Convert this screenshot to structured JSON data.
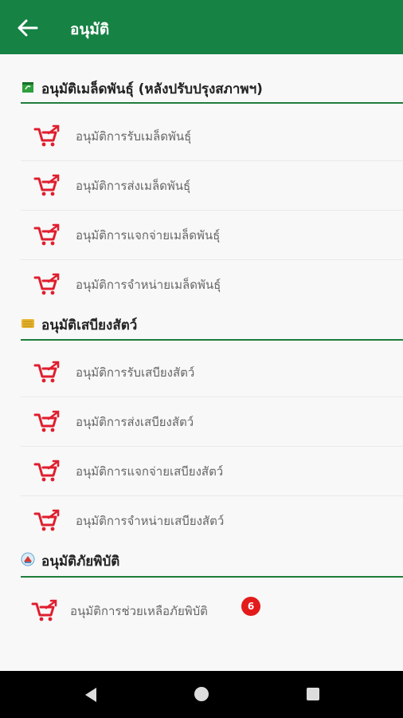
{
  "appbar": {
    "title": "อนุมัติ"
  },
  "sections": [
    {
      "title": "อนุมัติเมล็ดพันธุ์ (หลังปรับปรุงสภาพฯ)",
      "icon": "seed-box-icon",
      "items": [
        {
          "label": "อนุมัติการรับเมล็ดพันธุ์",
          "icon": "cart-icon"
        },
        {
          "label": "อนุมัติการส่งเมล็ดพันธุ์",
          "icon": "cart-icon"
        },
        {
          "label": "อนุมัติการแจกจ่ายเมล็ดพันธุ์",
          "icon": "cart-icon"
        },
        {
          "label": "อนุมัติการจำหน่ายเมล็ดพันธุ์",
          "icon": "cart-icon"
        }
      ]
    },
    {
      "title": "อนุมัติเสบียงสัตว์",
      "icon": "hay-icon",
      "items": [
        {
          "label": "อนุมัติการรับเสบียงสัตว์",
          "icon": "cart-icon"
        },
        {
          "label": "อนุมัติการส่งเสบียงสัตว์",
          "icon": "cart-icon"
        },
        {
          "label": "อนุมัติการแจกจ่ายเสบียงสัตว์",
          "icon": "cart-icon"
        },
        {
          "label": "อนุมัติการจำหน่ายเสบียงสัตว์",
          "icon": "cart-icon"
        }
      ]
    },
    {
      "title": "อนุมัติภัยพิบัติ",
      "icon": "disaster-icon",
      "items": [
        {
          "label": "อนุมัติการช่วยเหลือภัยพิบัติ",
          "icon": "cart-icon",
          "badge": "6"
        }
      ]
    }
  ],
  "colors": {
    "primary": "#168244",
    "divider_line": "#1e7e3a",
    "cart": "#e01e2e",
    "badge": "#e31b1b"
  }
}
